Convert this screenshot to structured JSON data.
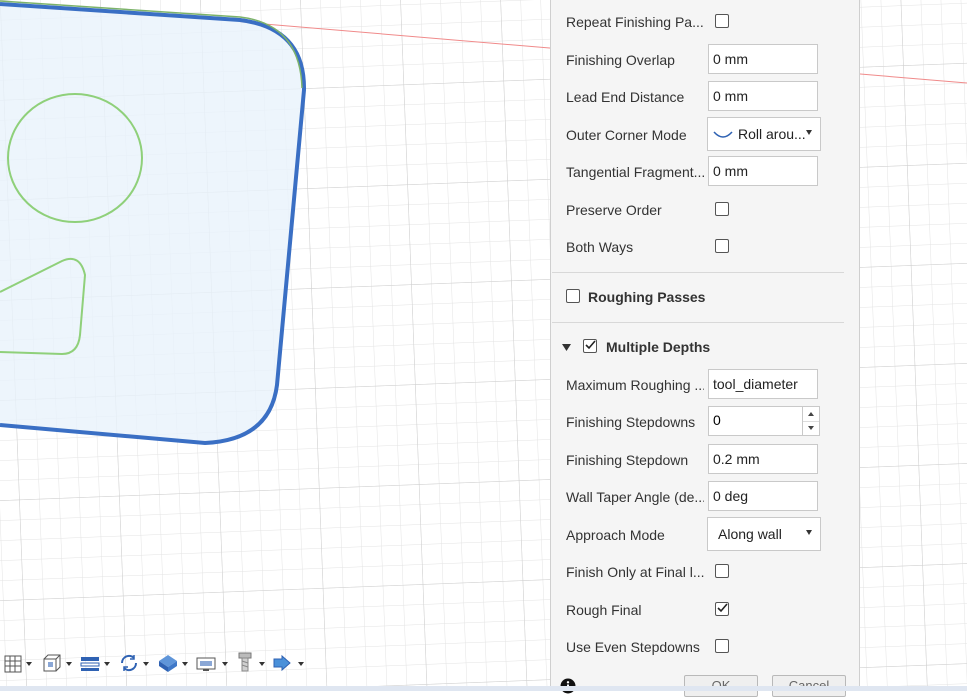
{
  "panel": {
    "rows_top": [
      {
        "label": "Repeat Finishing Pa...",
        "type": "checkbox",
        "checked": false
      },
      {
        "label": "Finishing Overlap",
        "type": "text",
        "value": "0 mm"
      },
      {
        "label": "Lead End Distance",
        "type": "text",
        "value": "0 mm"
      },
      {
        "label": "Outer Corner Mode",
        "type": "dropdown",
        "value": "Roll arou...",
        "icon": "arc-icon"
      },
      {
        "label": "Tangential Fragment...",
        "type": "text",
        "value": "0 mm"
      },
      {
        "label": "Preserve Order",
        "type": "checkbox",
        "checked": false
      },
      {
        "label": "Both Ways",
        "type": "checkbox",
        "checked": false
      }
    ],
    "roughing_passes": {
      "title": "Roughing Passes",
      "checked": false
    },
    "multiple_depths": {
      "title": "Multiple Depths",
      "checked": true,
      "expanded": true,
      "rows": [
        {
          "label": "Maximum Roughing ...",
          "type": "text",
          "value": "tool_diameter"
        },
        {
          "label": "Finishing Stepdowns",
          "type": "stepper",
          "value": "0"
        },
        {
          "label": "Finishing Stepdown",
          "type": "text",
          "value": "0.2 mm"
        },
        {
          "label": "Wall Taper Angle (de...",
          "type": "text",
          "value": "0 deg"
        },
        {
          "label": "Approach Mode",
          "type": "dropdown",
          "value": "Along wall"
        },
        {
          "label": "Finish Only at Final l...",
          "type": "checkbox",
          "checked": false
        },
        {
          "label": "Rough Final",
          "type": "checkbox",
          "checked": true
        },
        {
          "label": "Use Even Stepdowns",
          "type": "checkbox",
          "checked": false
        }
      ]
    },
    "footer": {
      "ok_label": "OK",
      "cancel_label": "Cancel"
    }
  },
  "toolbar": {
    "items": [
      {
        "name": "display-grid-icon"
      },
      {
        "name": "view-cube-icon"
      },
      {
        "name": "layers-icon"
      },
      {
        "name": "orbit-icon"
      },
      {
        "name": "visual-style-icon"
      },
      {
        "name": "display-settings-icon"
      },
      {
        "name": "tool-icon"
      },
      {
        "name": "simulation-icon"
      }
    ]
  },
  "colors": {
    "grid_line": "#dcdcdc",
    "grid_major": "#c8c8c8",
    "axis_red": "#f08a8a",
    "selected_contour": "#3a6fc4",
    "sketch_green": "#8fd07a",
    "face_fill": "#e8f3fb",
    "panel_bg": "#f5f5f5"
  }
}
